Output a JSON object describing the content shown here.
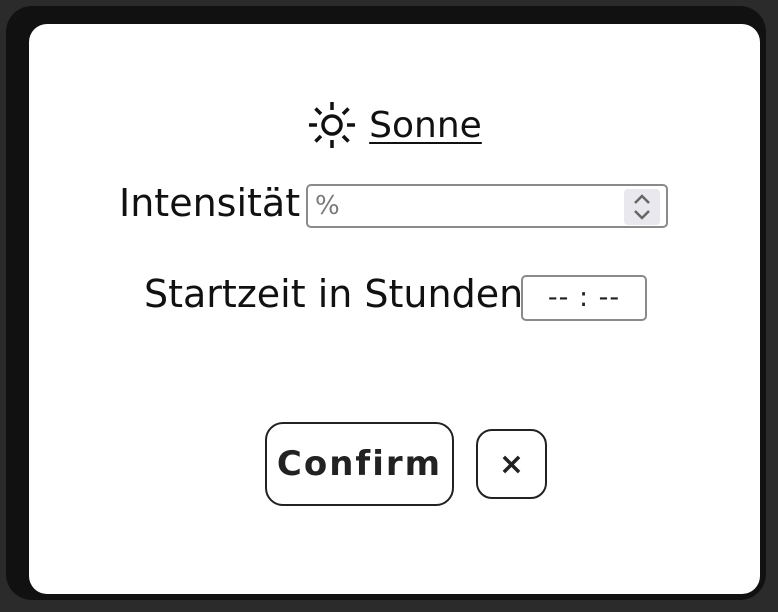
{
  "dialog": {
    "title": "Sonne",
    "title_icon": "sun-icon",
    "intensity": {
      "label": "Intensität",
      "placeholder": "%"
    },
    "start_time": {
      "label": "Startzeit in Stunden",
      "placeholder": "-- : --"
    },
    "confirm_label": "Confirm",
    "close_label": "×",
    "close_icon": "close-icon"
  }
}
